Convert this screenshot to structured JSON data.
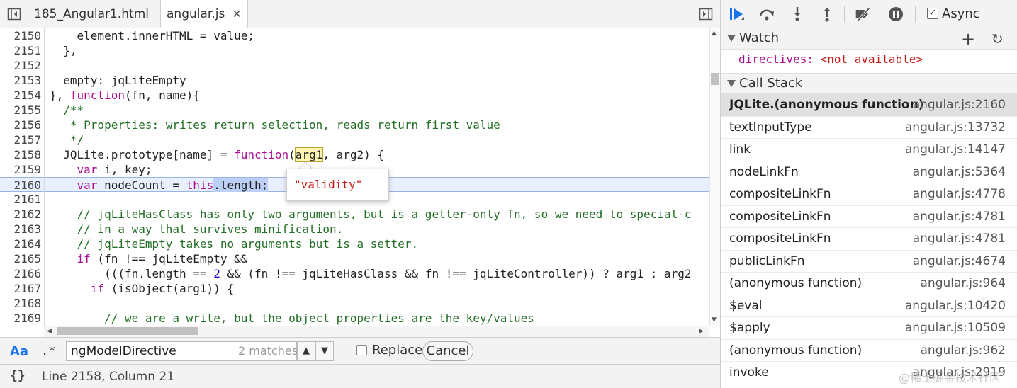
{
  "tabs": [
    {
      "label": "185_Angular1.html",
      "active": false
    },
    {
      "label": "angular.js",
      "active": true,
      "close": "✕"
    }
  ],
  "code_lines": [
    {
      "n": "2150",
      "segs": [
        {
          "t": "    element.innerHTML = value;"
        }
      ]
    },
    {
      "n": "2151",
      "segs": [
        {
          "t": "  },"
        }
      ]
    },
    {
      "n": "2152",
      "segs": [
        {
          "t": ""
        }
      ]
    },
    {
      "n": "2153",
      "segs": [
        {
          "t": "  empty: jqLiteEmpty"
        }
      ]
    },
    {
      "n": "2154",
      "segs": [
        {
          "t": "}, "
        },
        {
          "t": "function",
          "c": "kw"
        },
        {
          "t": "(fn, name){"
        }
      ]
    },
    {
      "n": "2155",
      "segs": [
        {
          "t": "  /**",
          "c": "cm"
        }
      ]
    },
    {
      "n": "2156",
      "segs": [
        {
          "t": "   * Properties: writes return selection, reads return first value",
          "c": "cm"
        }
      ]
    },
    {
      "n": "2157",
      "segs": [
        {
          "t": "   */",
          "c": "cm"
        }
      ]
    },
    {
      "n": "2158",
      "segs": [
        {
          "t": "  JQLite.prototype[name] = "
        },
        {
          "t": "function",
          "c": "kw"
        },
        {
          "t": "("
        },
        {
          "t": "arg1",
          "c": "mark-yellow"
        },
        {
          "t": ", arg2) {"
        }
      ]
    },
    {
      "n": "2159",
      "segs": [
        {
          "t": "    "
        },
        {
          "t": "var",
          "c": "kw"
        },
        {
          "t": " i, key;"
        }
      ]
    },
    {
      "n": "2160",
      "highlight": true,
      "segs": [
        {
          "t": "    "
        },
        {
          "t": "var",
          "c": "kw"
        },
        {
          "t": " nodeCount = "
        },
        {
          "t": "this",
          "c": "kw"
        },
        {
          "t": ".length;",
          "c": "mark-sel"
        }
      ]
    },
    {
      "n": "2161",
      "segs": [
        {
          "t": ""
        }
      ]
    },
    {
      "n": "2162",
      "segs": [
        {
          "t": "    // jqLiteHasClass has only two arguments, but is a getter-only fn, so we need to special-c",
          "c": "cm"
        }
      ]
    },
    {
      "n": "2163",
      "segs": [
        {
          "t": "    // in a way that survives minification.",
          "c": "cm"
        }
      ]
    },
    {
      "n": "2164",
      "segs": [
        {
          "t": "    // jqLiteEmpty takes no arguments but is a setter.",
          "c": "cm"
        }
      ]
    },
    {
      "n": "2165",
      "segs": [
        {
          "t": "    "
        },
        {
          "t": "if",
          "c": "kw"
        },
        {
          "t": " (fn !== jqLiteEmpty &&"
        }
      ]
    },
    {
      "n": "2166",
      "segs": [
        {
          "t": "        (((fn.length == "
        },
        {
          "t": "2",
          "c": "num"
        },
        {
          "t": " && (fn !== jqLiteHasClass && fn !== jqLiteController)) ? arg1 : arg2"
        }
      ]
    },
    {
      "n": "2167",
      "segs": [
        {
          "t": "      "
        },
        {
          "t": "if",
          "c": "kw"
        },
        {
          "t": " (isObject(arg1)) {"
        }
      ]
    },
    {
      "n": "2168",
      "segs": [
        {
          "t": ""
        }
      ]
    },
    {
      "n": "2169",
      "segs": [
        {
          "t": "        // we are a write, but the object properties are the key/values",
          "c": "cm"
        }
      ]
    },
    {
      "n": "2170",
      "segs": [
        {
          "t": ""
        }
      ]
    }
  ],
  "tooltip": {
    "value": "\"validity\""
  },
  "search": {
    "case_toggle": "Aa",
    "regex_toggle": ".*",
    "query": "ngModelDirective",
    "match_count": "2 matches",
    "replace_label": "Replace",
    "cancel_label": "Cancel"
  },
  "status": {
    "pretty_print": "{}",
    "cursor": "Line 2158, Column 21"
  },
  "debugger": {
    "async_label": "Async",
    "async_checked": "✓",
    "watch_title": "Watch",
    "watch_add": "+",
    "watch_refresh": "↻",
    "watch_expr": {
      "name": "directives",
      "sep": ": ",
      "value": "<not available>"
    },
    "callstack_title": "Call Stack",
    "frames": [
      {
        "name": "JQLite.(anonymous function)",
        "loc": "angular.js:2160",
        "selected": true
      },
      {
        "name": "textInputType",
        "loc": "angular.js:13732"
      },
      {
        "name": "link",
        "loc": "angular.js:14147"
      },
      {
        "name": "nodeLinkFn",
        "loc": "angular.js:5364"
      },
      {
        "name": "compositeLinkFn",
        "loc": "angular.js:4778"
      },
      {
        "name": "compositeLinkFn",
        "loc": "angular.js:4781"
      },
      {
        "name": "compositeLinkFn",
        "loc": "angular.js:4781"
      },
      {
        "name": "publicLinkFn",
        "loc": "angular.js:4674"
      },
      {
        "name": "(anonymous function)",
        "loc": "angular.js:964"
      },
      {
        "name": "$eval",
        "loc": "angular.js:10420"
      },
      {
        "name": "$apply",
        "loc": "angular.js:10509"
      },
      {
        "name": "(anonymous function)",
        "loc": "angular.js:962"
      },
      {
        "name": "invoke",
        "loc": "angular.js:2919"
      }
    ]
  },
  "watermark": "@稀土掘金技术社区",
  "colors": {
    "accent": "#1a73e8",
    "keyword": "#aa0d91",
    "comment": "#236e25",
    "string": "#c41a16",
    "highlight_line": "#e8efff"
  }
}
